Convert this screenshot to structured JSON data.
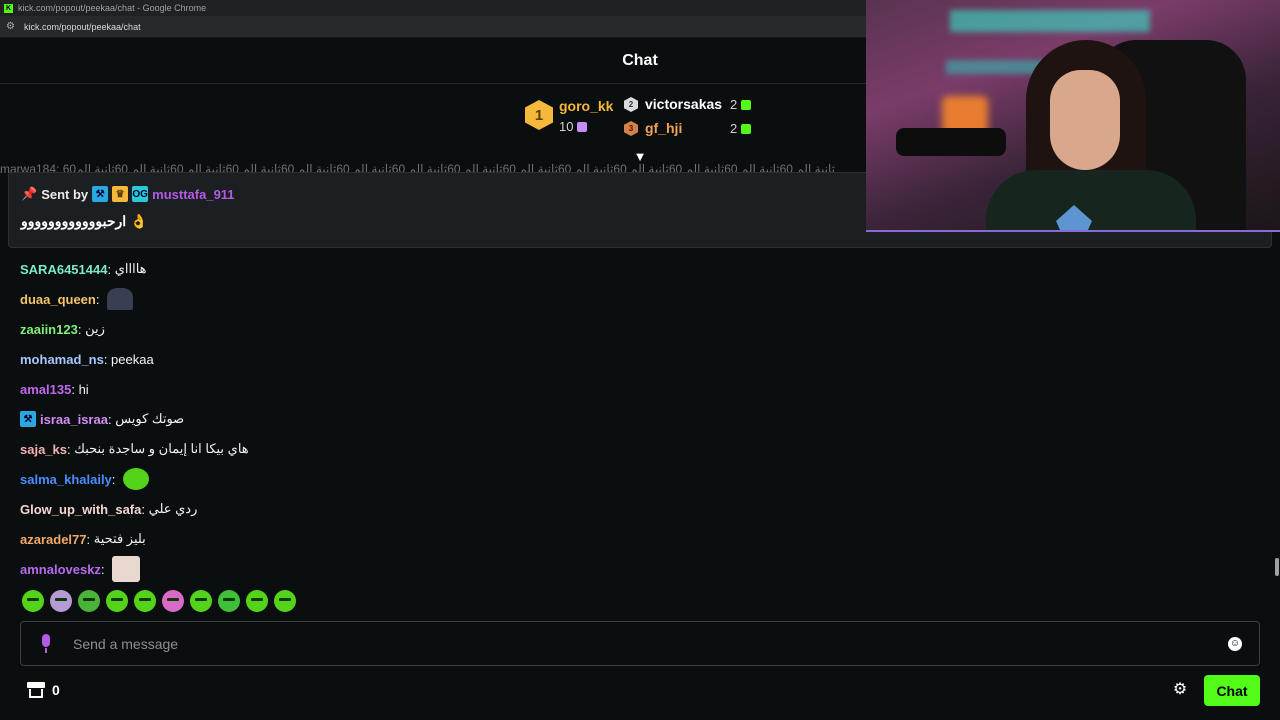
{
  "browser": {
    "window_title": "kick.com/popout/peekaa/chat - Google Chrome",
    "url": "kick.com/popout/peekaa/chat"
  },
  "header": {
    "title": "Chat"
  },
  "leaderboard": {
    "first": {
      "rank": "1",
      "name": "goro_kk",
      "count": "10"
    },
    "second": {
      "rank": "2",
      "name": "victorsakas",
      "count": "2"
    },
    "third": {
      "rank": "3",
      "name": "gf_hji",
      "count": "2"
    }
  },
  "ticker_text": "marwa184: 60ثانية الم 60ثانية الم 60ثانية الم 60ثانية الم 60ثانية الم 60ثانية الم 60ثانية الم 60ثانية الم 60ثانية الم 60ثانية الم 60ثانية الم 60ثانية الم 60ثانية الم 60ثانية الم",
  "pinned": {
    "sent_by_label": "Sent by",
    "user": "musttafa_911",
    "message": "ارحبوووووووووووو 👌"
  },
  "messages": [
    {
      "user": "SARA6451444",
      "text": "هااااي",
      "color": "#7ee8c7"
    },
    {
      "user": "duaa_queen",
      "text": "",
      "color": "#f5c36a",
      "emote": "emote-image"
    },
    {
      "user": "zaaiin123",
      "text": "زين",
      "color": "#7ef07a"
    },
    {
      "user": "mohamad_ns",
      "text": "peekaa",
      "color": "#a7c6ff"
    },
    {
      "user": "amal135",
      "text": "hi",
      "color": "#c266f0"
    },
    {
      "user": "israa_israa",
      "text": "صوتك كويس",
      "color": "#d28cf5"
    },
    {
      "user": "saja_ks",
      "text": "هاي بيكا انا إيمان و ساجدة بنحبك",
      "color": "#f2b2b2"
    },
    {
      "user": "salma_khalaily",
      "text": "",
      "color": "#4a8dff",
      "emote": "emote-image"
    },
    {
      "user": "Glow_up_with_safa",
      "text": "ردي علي",
      "color": "#f4d6d0"
    },
    {
      "user": "azaradel77",
      "text": "بليز فتحية",
      "color": "#f3a86a"
    },
    {
      "user": "amnaloveskz",
      "text": "",
      "color": "#b76af0",
      "emote": "emote-image"
    }
  ],
  "emote_bar": [
    "emote-1",
    "emote-2",
    "emote-3",
    "emote-4",
    "emote-5",
    "emote-6",
    "emote-7",
    "emote-8",
    "emote-9",
    "emote-10"
  ],
  "input": {
    "placeholder": "Send a message"
  },
  "footer": {
    "store_count": "0",
    "chat_button": "Chat"
  },
  "colors": {
    "accent": "#53fc18",
    "background": "#0b0e0f",
    "pinned_bg": "#1c1f21"
  }
}
